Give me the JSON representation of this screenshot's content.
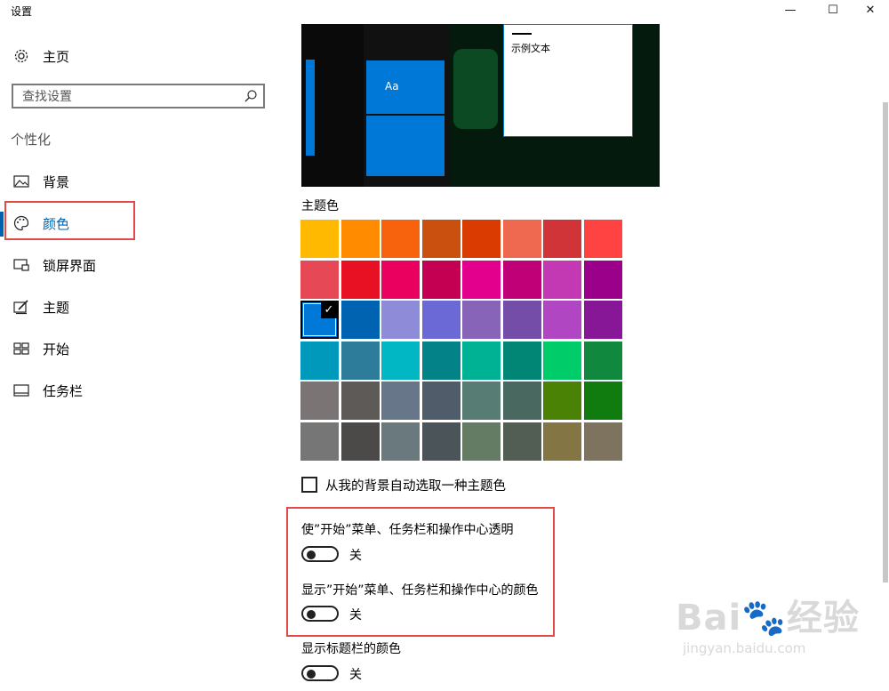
{
  "window": {
    "title": "设置",
    "minimize_glyph": "—",
    "maximize_glyph": "☐",
    "close_glyph": "✕"
  },
  "sidebar": {
    "home_label": "主页",
    "search_placeholder": "查找设置",
    "section_label": "个性化",
    "items": [
      {
        "label": "背景",
        "icon": "picture-icon"
      },
      {
        "label": "颜色",
        "icon": "palette-icon",
        "selected": true
      },
      {
        "label": "锁屏界面",
        "icon": "lock-screen-icon"
      },
      {
        "label": "主题",
        "icon": "theme-icon"
      },
      {
        "label": "开始",
        "icon": "start-icon"
      },
      {
        "label": "任务栏",
        "icon": "taskbar-icon"
      }
    ]
  },
  "preview": {
    "tile_text": "Aa",
    "sample_text": "示例文本"
  },
  "accent": {
    "label": "主题色",
    "selected_index": 16,
    "colors": [
      "#FFB900",
      "#FF8C00",
      "#F7630C",
      "#CA5010",
      "#DA3B01",
      "#EF6950",
      "#D13438",
      "#FF4343",
      "#E74856",
      "#E81123",
      "#EA005E",
      "#C30052",
      "#E3008C",
      "#BF0077",
      "#C239B3",
      "#9A0089",
      "#0078D7",
      "#0063B1",
      "#8E8CD8",
      "#6B69D6",
      "#8764B8",
      "#744DA9",
      "#B146C2",
      "#881798",
      "#0099BC",
      "#2D7D9A",
      "#00B7C3",
      "#038387",
      "#00B294",
      "#018574",
      "#00CC6A",
      "#10893E",
      "#7A7574",
      "#5D5A58",
      "#68768A",
      "#515C6B",
      "#567C73",
      "#486860",
      "#498205",
      "#107C10",
      "#767676",
      "#4C4A48",
      "#69797E",
      "#4A5459",
      "#647C64",
      "#525E54",
      "#847545",
      "#7E735F"
    ]
  },
  "options": {
    "auto_pick_label": "从我的背景自动选取一种主题色",
    "transparency_label": "使”开始”菜单、任务栏和操作中心透明",
    "transparency_state": "关",
    "show_color_start_label": "显示”开始”菜单、任务栏和操作中心的颜色",
    "show_color_start_state": "关",
    "show_color_title_label": "显示标题栏的颜色",
    "show_color_title_state": "关"
  },
  "watermark": {
    "brand": "Bai",
    "brand_suffix": "经验",
    "url": "jingyan.baidu.com"
  },
  "colors": {
    "accent": "#0078D7",
    "highlight_box": "#E24A4A"
  }
}
